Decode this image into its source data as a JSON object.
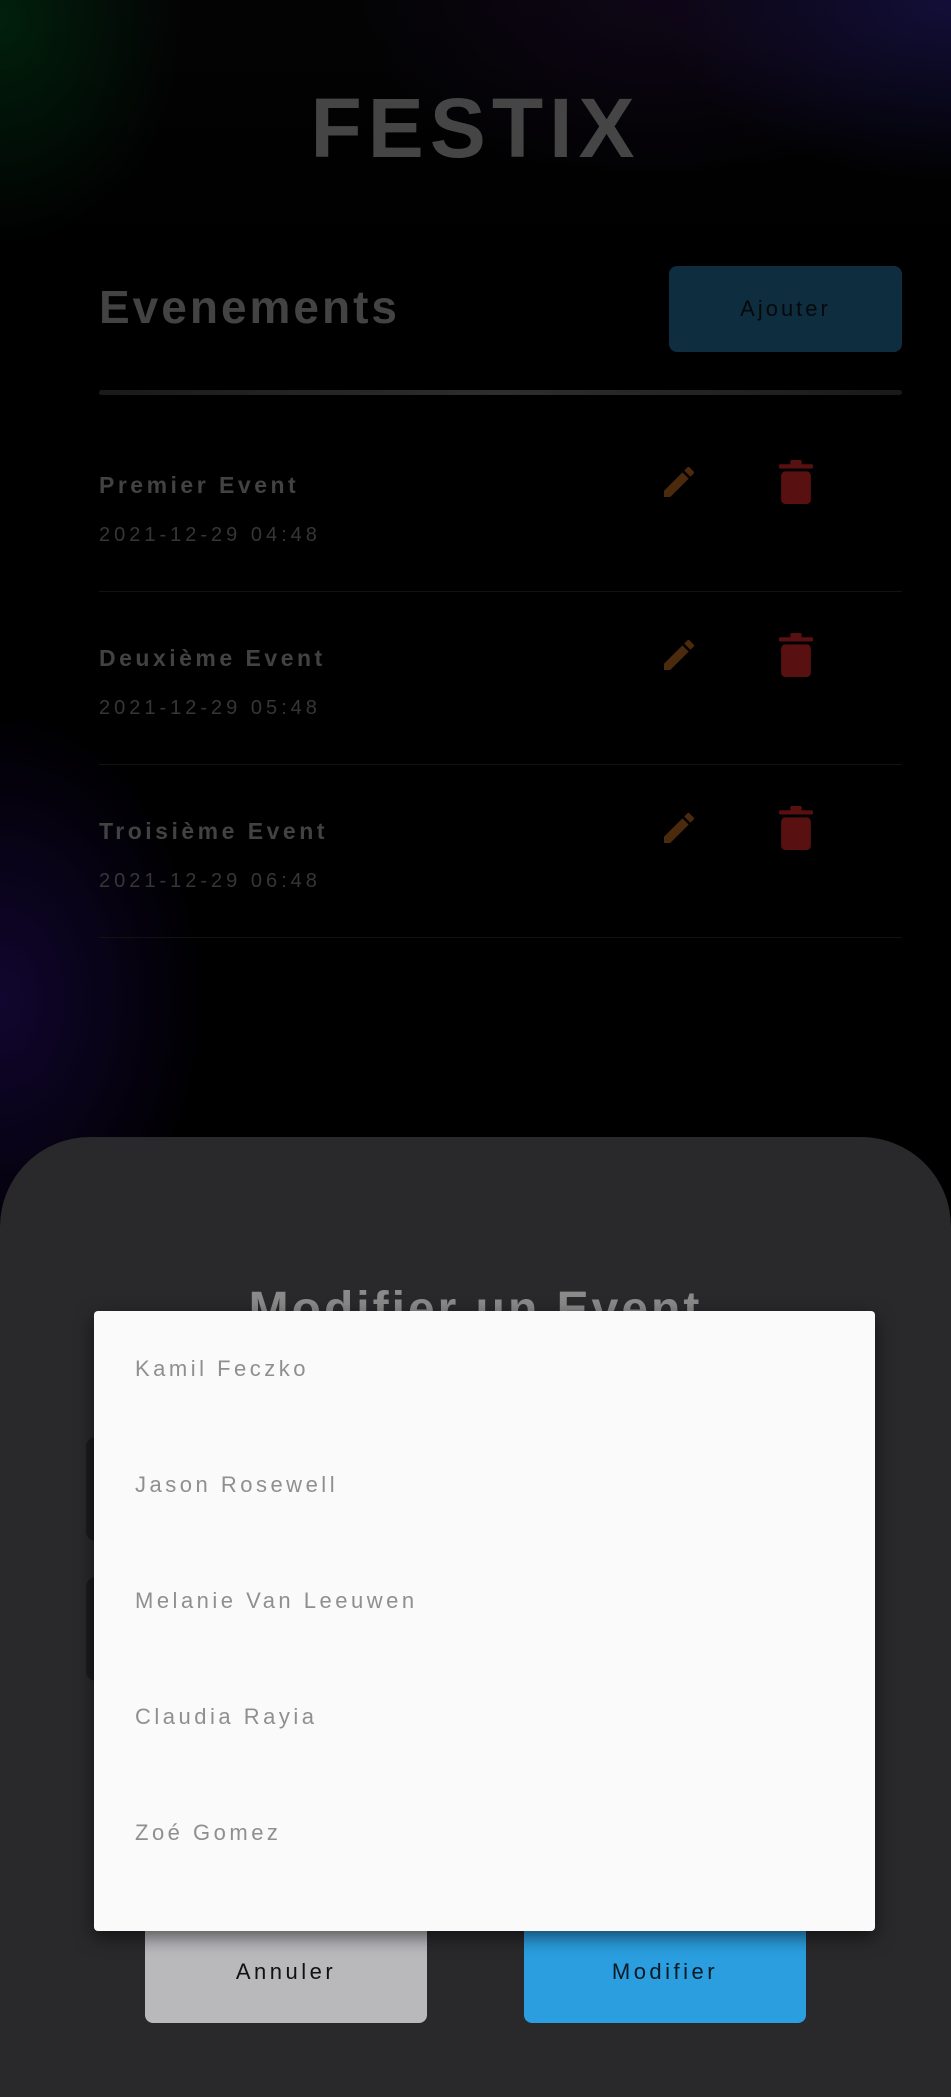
{
  "app_title": "FESTIX",
  "events_section": {
    "title": "Evenements",
    "add_label": "Ajouter",
    "items": [
      {
        "name": "Premier Event",
        "date": "2021-12-29 04:48"
      },
      {
        "name": "Deuxième Event",
        "date": "2021-12-29 05:48"
      },
      {
        "name": "Troisième Event",
        "date": "2021-12-29 06:48"
      }
    ]
  },
  "modal": {
    "title": "Modifier un Event",
    "cancel_label": "Annuler",
    "submit_label": "Modifier"
  },
  "dropdown": {
    "options": [
      "Kamil Feczko",
      "Jason Rosewell",
      "Melanie Van Leeuwen",
      "Claudia Rayia",
      "Zoé Gomez"
    ]
  },
  "icons": {
    "edit": "pencil-icon",
    "delete": "trash-icon"
  },
  "colors": {
    "accent_blue": "#2a9edf",
    "edit_icon": "#7a4517",
    "delete_icon": "#8e1b1b",
    "sheet_bg": "#29282b"
  }
}
